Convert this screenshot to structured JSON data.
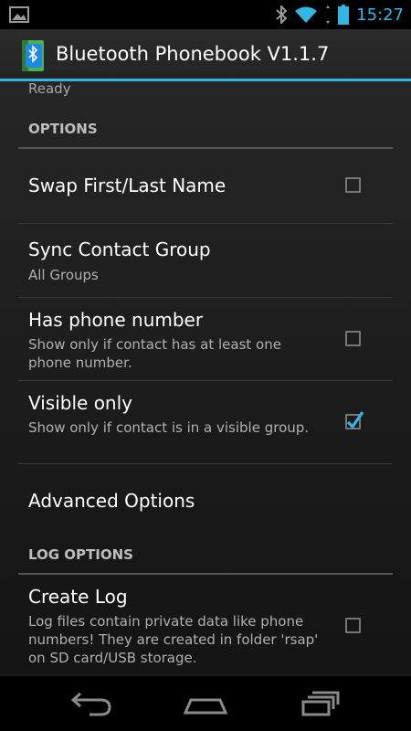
{
  "status_bar": {
    "time": "15:27",
    "icons": [
      "image-notification-icon",
      "bluetooth-icon",
      "wifi-icon",
      "battery-icon"
    ]
  },
  "action_bar": {
    "title": "Bluetooth Phonebook V1.1.7",
    "icon": "phonebook-bluetooth-icon"
  },
  "content": {
    "top_summary": "Ready",
    "sections": [
      {
        "header": "OPTIONS",
        "items": [
          {
            "title": "Swap First/Last Name",
            "summary": "",
            "checkbox": true,
            "checked": false
          },
          {
            "title": "Sync Contact Group",
            "summary": "All Groups",
            "checkbox": false,
            "checked": false
          },
          {
            "title": "Has phone number",
            "summary": "Show only if contact has at least one phone number.",
            "checkbox": true,
            "checked": false
          },
          {
            "title": "Visible only",
            "summary": "Show only if contact is in a visible group.",
            "checkbox": true,
            "checked": true
          },
          {
            "title": "Advanced Options",
            "summary": "",
            "checkbox": false,
            "checked": false
          }
        ]
      },
      {
        "header": "LOG OPTIONS",
        "items": [
          {
            "title": "Create Log",
            "summary": "Log files contain private data like phone numbers! They are created in folder 'rsap' on SD card/USB storage.",
            "checkbox": true,
            "checked": false
          }
        ]
      }
    ]
  },
  "nav_bar": {
    "buttons": [
      "back-icon",
      "home-icon",
      "recent-apps-icon"
    ]
  },
  "colors": {
    "accent": "#33b5e5",
    "background": "#1c1c1c"
  }
}
